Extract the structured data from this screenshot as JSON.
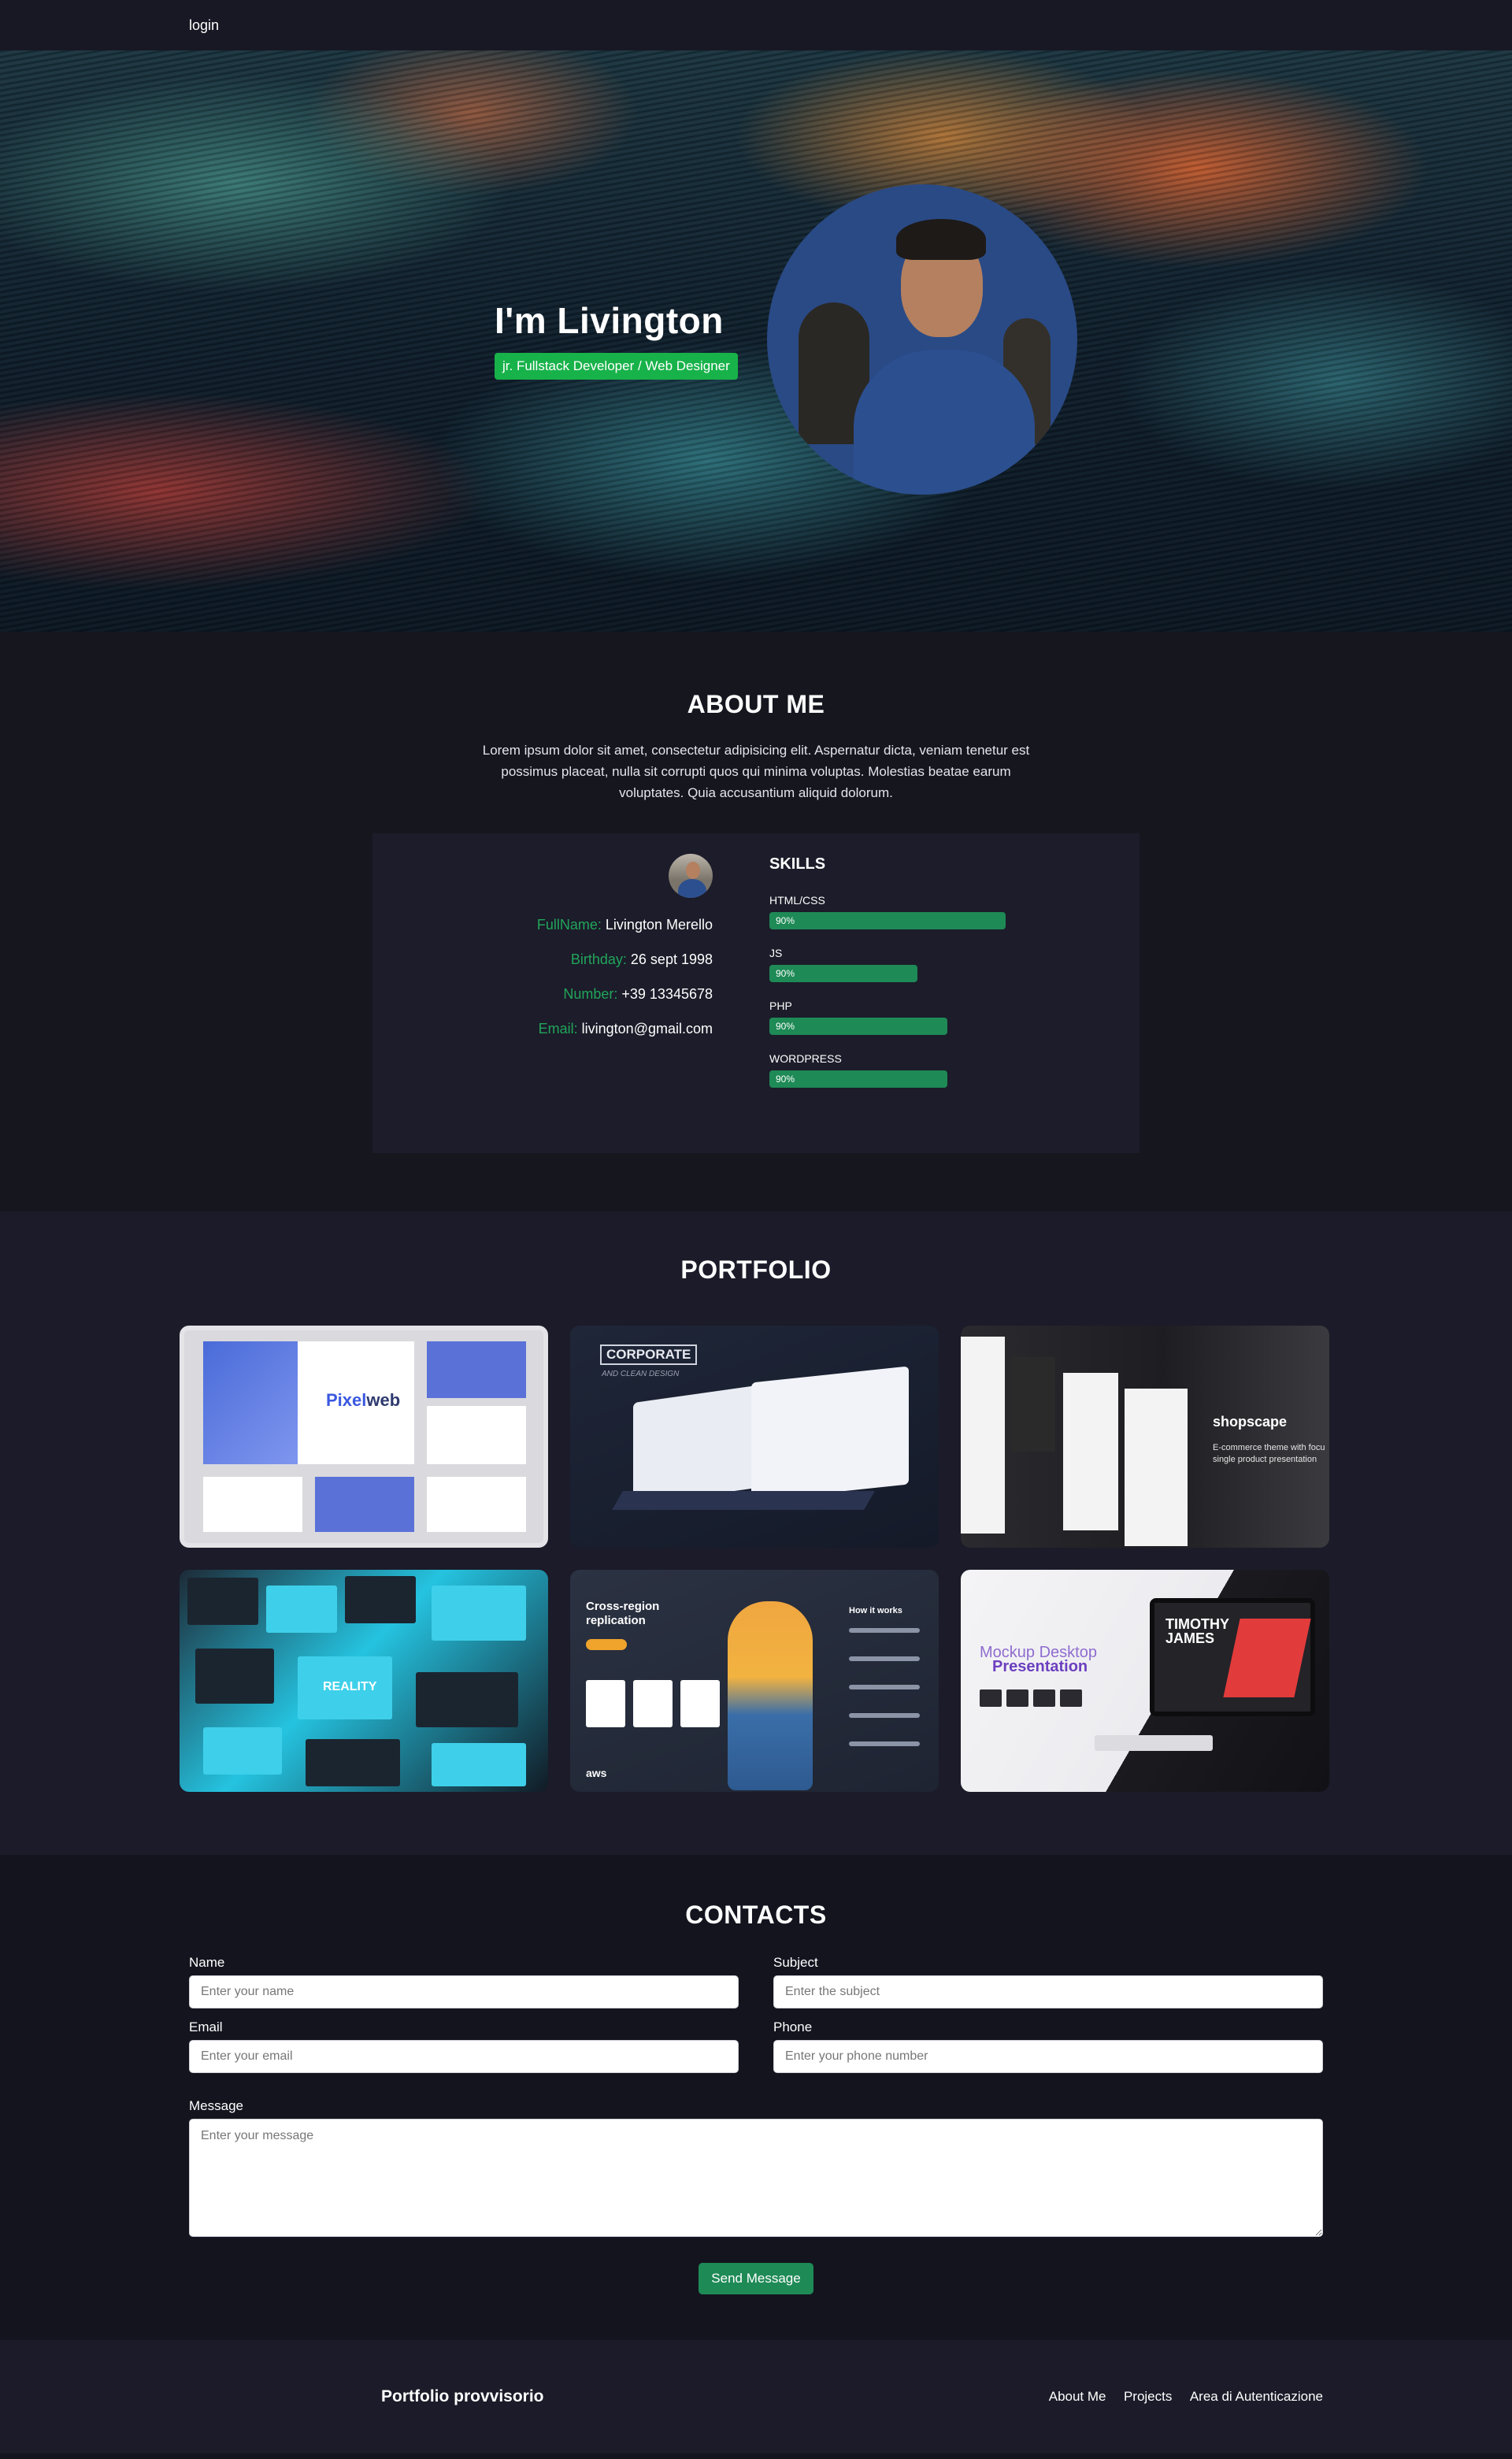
{
  "nav": {
    "login_label": "login"
  },
  "hero": {
    "title": "I'm Livington",
    "badge": "jr. Fullstack Developer / Web Designer"
  },
  "about": {
    "title": "ABOUT ME",
    "text": "Lorem ipsum dolor sit amet, consectetur adipisicing elit. Aspernatur dicta, veniam tenetur est possimus placeat, nulla sit corrupti quos qui minima voluptas. Molestias beatae earum voluptates. Quia accusantium aliquid dolorum.",
    "info": [
      {
        "label": "FullName:",
        "value": "Livington Merello"
      },
      {
        "label": "Birthday:",
        "value": "26 sept 1998"
      },
      {
        "label": "Number:",
        "value": "+39 13345678"
      },
      {
        "label": "Email:",
        "value": "livington@gmail.com"
      }
    ],
    "skills_title": "SKILLS",
    "skills": [
      {
        "name": "HTML/CSS",
        "percent_label": "90%"
      },
      {
        "name": "JS",
        "percent_label": "90%"
      },
      {
        "name": "PHP",
        "percent_label": "90%"
      },
      {
        "name": "WORDPRESS",
        "percent_label": "90%"
      }
    ]
  },
  "portfolio": {
    "title": "PORTFOLIO",
    "cards": [
      {
        "logo_a": "Pixel",
        "logo_b": "web"
      },
      {
        "label": "CORPORATE",
        "sub": "AND CLEAN DESIGN"
      },
      {
        "brand": "shopscape",
        "tag_1": "E-commerce theme with focu",
        "tag_2": "single product presentation"
      },
      {
        "text": "REALITY"
      },
      {
        "heading_1": "Cross-region",
        "heading_2": "replication",
        "how": "How it works",
        "aws": "aws"
      },
      {
        "title_1": "Mockup Desktop",
        "title_2": "Presentation",
        "name_1": "TIMOTHY",
        "name_2": "JAMES"
      }
    ]
  },
  "contacts": {
    "title": "CONTACTS",
    "name_label": "Name",
    "name_placeholder": "Enter your name",
    "subject_label": "Subject",
    "subject_placeholder": "Enter the subject",
    "email_label": "Email",
    "email_placeholder": "Enter your email",
    "phone_label": "Phone",
    "phone_placeholder": "Enter your phone number",
    "message_label": "Message",
    "message_placeholder": "Enter your message",
    "send_label": "Send Message"
  },
  "footer": {
    "brand": "Portfolio provvisorio",
    "links": [
      "About Me",
      "Projects",
      "Area di Autenticazione"
    ]
  }
}
